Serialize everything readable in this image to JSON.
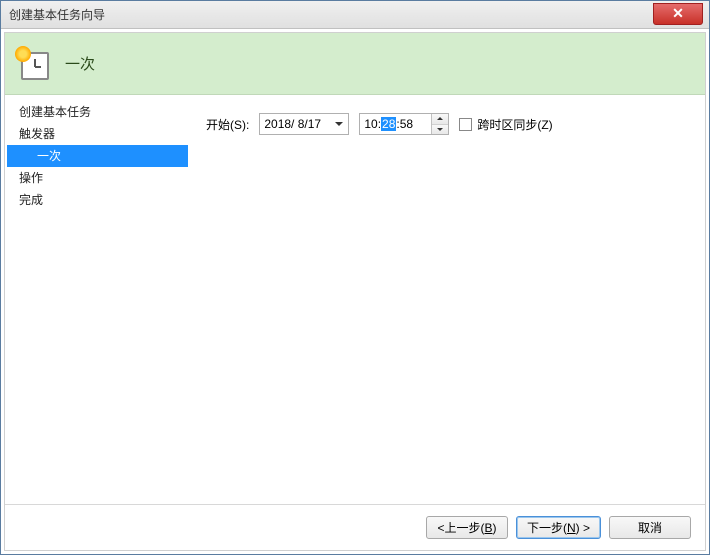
{
  "window": {
    "title": "创建基本任务向导"
  },
  "header": {
    "title": "一次"
  },
  "sidebar": {
    "items": [
      {
        "label": "创建基本任务",
        "sub": false,
        "active": false
      },
      {
        "label": "触发器",
        "sub": false,
        "active": false
      },
      {
        "label": "一次",
        "sub": true,
        "active": true
      },
      {
        "label": "操作",
        "sub": false,
        "active": false
      },
      {
        "label": "完成",
        "sub": false,
        "active": false
      }
    ]
  },
  "main": {
    "start_label": "开始(S):",
    "date_value": "2018/ 8/17",
    "time_hour": "10",
    "time_minute_selected": "28",
    "time_second": "58",
    "sync_checkbox_label": "跨时区同步(Z)",
    "sync_checked": false
  },
  "footer": {
    "back_prefix": "<上一步(",
    "back_hotkey": "B",
    "back_suffix": ")",
    "next_prefix": "下一步(",
    "next_hotkey": "N",
    "next_suffix": ") >",
    "cancel": "取消"
  }
}
